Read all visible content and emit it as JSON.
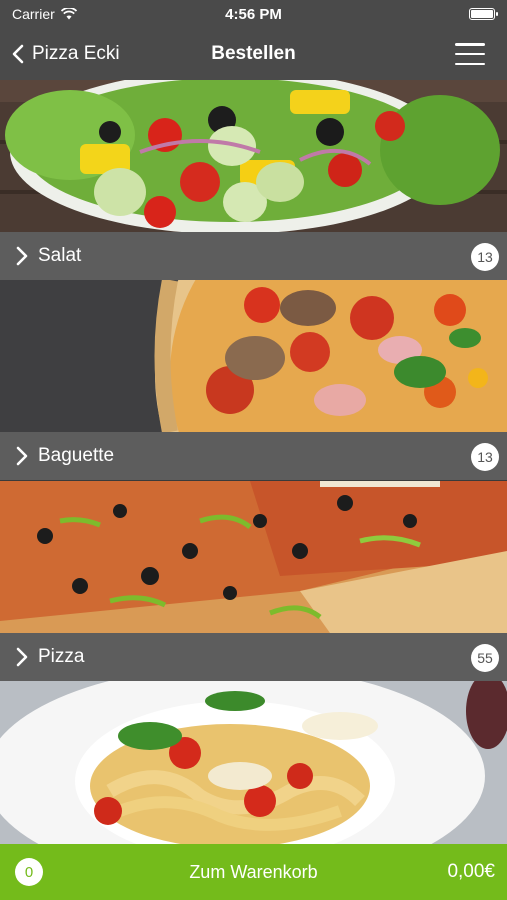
{
  "status": {
    "carrier": "Carrier",
    "time": "4:56 PM",
    "battery_level": 1.0
  },
  "nav": {
    "back_label": "Pizza Ecki",
    "title": "Bestellen"
  },
  "categories": [
    {
      "label": "Salat",
      "count": "13"
    },
    {
      "label": "Baguette",
      "count": "13"
    },
    {
      "label": "Pizza",
      "count": "55"
    }
  ],
  "cart": {
    "count": "0",
    "label": "Zum Warenkorb",
    "total": "0,00€"
  },
  "colors": {
    "accent": "#74bb1b",
    "bar": "#5d5d5d",
    "nav": "#4a4a4a"
  }
}
